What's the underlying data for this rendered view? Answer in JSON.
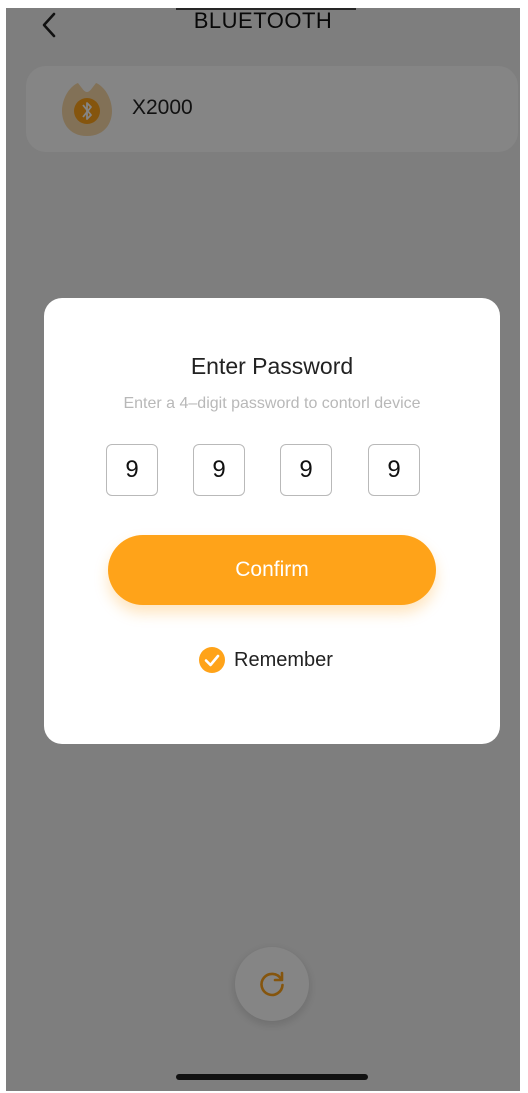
{
  "header": {
    "title": "BLUETOOTH",
    "back_icon": "chevron-left-icon"
  },
  "device_list": [
    {
      "name": "X2000",
      "icon": "bluetooth-icon"
    }
  ],
  "dialog": {
    "title": "Enter Password",
    "subtitle": "Enter a 4–digit password to contorl device",
    "pin_digits": [
      "9",
      "9",
      "9",
      "9"
    ],
    "confirm_label": "Confirm",
    "remember_label": "Remember",
    "remember_checked": true
  },
  "refresh": {
    "icon": "refresh-icon"
  },
  "colors": {
    "accent": "#ffa319",
    "overlay": "rgba(0,0,0,0.48)",
    "card_background": "#ffffff"
  }
}
